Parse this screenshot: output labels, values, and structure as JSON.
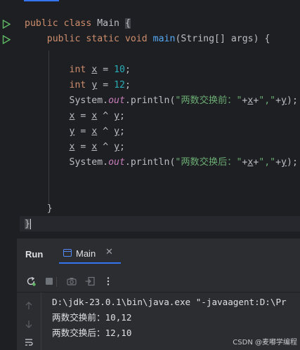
{
  "editor": {
    "lines": [
      [
        {
          "t": "public",
          "c": "kw"
        },
        {
          "t": " "
        },
        {
          "t": "class",
          "c": "kw"
        },
        {
          "t": " Main "
        },
        {
          "t": "{",
          "c": "brace-hl"
        }
      ],
      [
        {
          "t": "    "
        },
        {
          "t": "public",
          "c": "kw"
        },
        {
          "t": " "
        },
        {
          "t": "static",
          "c": "kw"
        },
        {
          "t": " "
        },
        {
          "t": "void",
          "c": "kw"
        },
        {
          "t": " "
        },
        {
          "t": "main",
          "c": "fn"
        },
        {
          "t": "(String[] args) {"
        }
      ],
      [],
      [
        {
          "t": "        "
        },
        {
          "t": "int",
          "c": "kw"
        },
        {
          "t": " "
        },
        {
          "t": "x",
          "c": "var"
        },
        {
          "t": " = "
        },
        {
          "t": "10",
          "c": "num"
        },
        {
          "t": ";"
        }
      ],
      [
        {
          "t": "        "
        },
        {
          "t": "int",
          "c": "kw"
        },
        {
          "t": " "
        },
        {
          "t": "y",
          "c": "var"
        },
        {
          "t": " = "
        },
        {
          "t": "12",
          "c": "num"
        },
        {
          "t": ";"
        }
      ],
      [
        {
          "t": "        System."
        },
        {
          "t": "out",
          "c": "fld"
        },
        {
          "t": ".println("
        },
        {
          "t": "\"两数交换前：\"",
          "c": "str"
        },
        {
          "t": "+"
        },
        {
          "t": "x",
          "c": "var"
        },
        {
          "t": "+"
        },
        {
          "t": "\",\"",
          "c": "str"
        },
        {
          "t": "+"
        },
        {
          "t": "y",
          "c": "var"
        },
        {
          "t": ");"
        }
      ],
      [
        {
          "t": "        "
        },
        {
          "t": "x",
          "c": "var"
        },
        {
          "t": " = "
        },
        {
          "t": "x",
          "c": "var"
        },
        {
          "t": " ^ "
        },
        {
          "t": "y",
          "c": "var"
        },
        {
          "t": ";"
        }
      ],
      [
        {
          "t": "        "
        },
        {
          "t": "y",
          "c": "var"
        },
        {
          "t": " = "
        },
        {
          "t": "x",
          "c": "var"
        },
        {
          "t": " ^ "
        },
        {
          "t": "y",
          "c": "var"
        },
        {
          "t": ";"
        }
      ],
      [
        {
          "t": "        "
        },
        {
          "t": "x",
          "c": "var"
        },
        {
          "t": " = "
        },
        {
          "t": "x",
          "c": "var"
        },
        {
          "t": " ^ "
        },
        {
          "t": "y",
          "c": "var"
        },
        {
          "t": ";"
        }
      ],
      [
        {
          "t": "        System."
        },
        {
          "t": "out",
          "c": "fld"
        },
        {
          "t": ".println("
        },
        {
          "t": "\"两数交换后：\"",
          "c": "str"
        },
        {
          "t": "+"
        },
        {
          "t": "x",
          "c": "var"
        },
        {
          "t": "+"
        },
        {
          "t": "\",\"",
          "c": "str"
        },
        {
          "t": "+"
        },
        {
          "t": "y",
          "c": "var"
        },
        {
          "t": ");"
        }
      ],
      [],
      [],
      [
        {
          "t": "    }"
        }
      ],
      [
        {
          "t": "}",
          "c": "brace-hl"
        },
        {
          "caret": true
        }
      ]
    ]
  },
  "run_panel": {
    "title": "Run",
    "tab_label": "Main",
    "tab_close": "✕",
    "console_lines": [
      "D:\\jdk-23.0.1\\bin\\java.exe \"-javaagent:D:\\Pr",
      "两数交换前：10,12",
      "两数交换后：12,10"
    ]
  },
  "watermark": "CSDN @麦嘟学编程",
  "colors": {
    "keyword": "#cf8e6d",
    "function": "#56a8f5",
    "number": "#2aacb8",
    "string": "#6aab73",
    "field": "#c77dbb",
    "accent": "#3574f0",
    "run_green": "#5fb865"
  }
}
